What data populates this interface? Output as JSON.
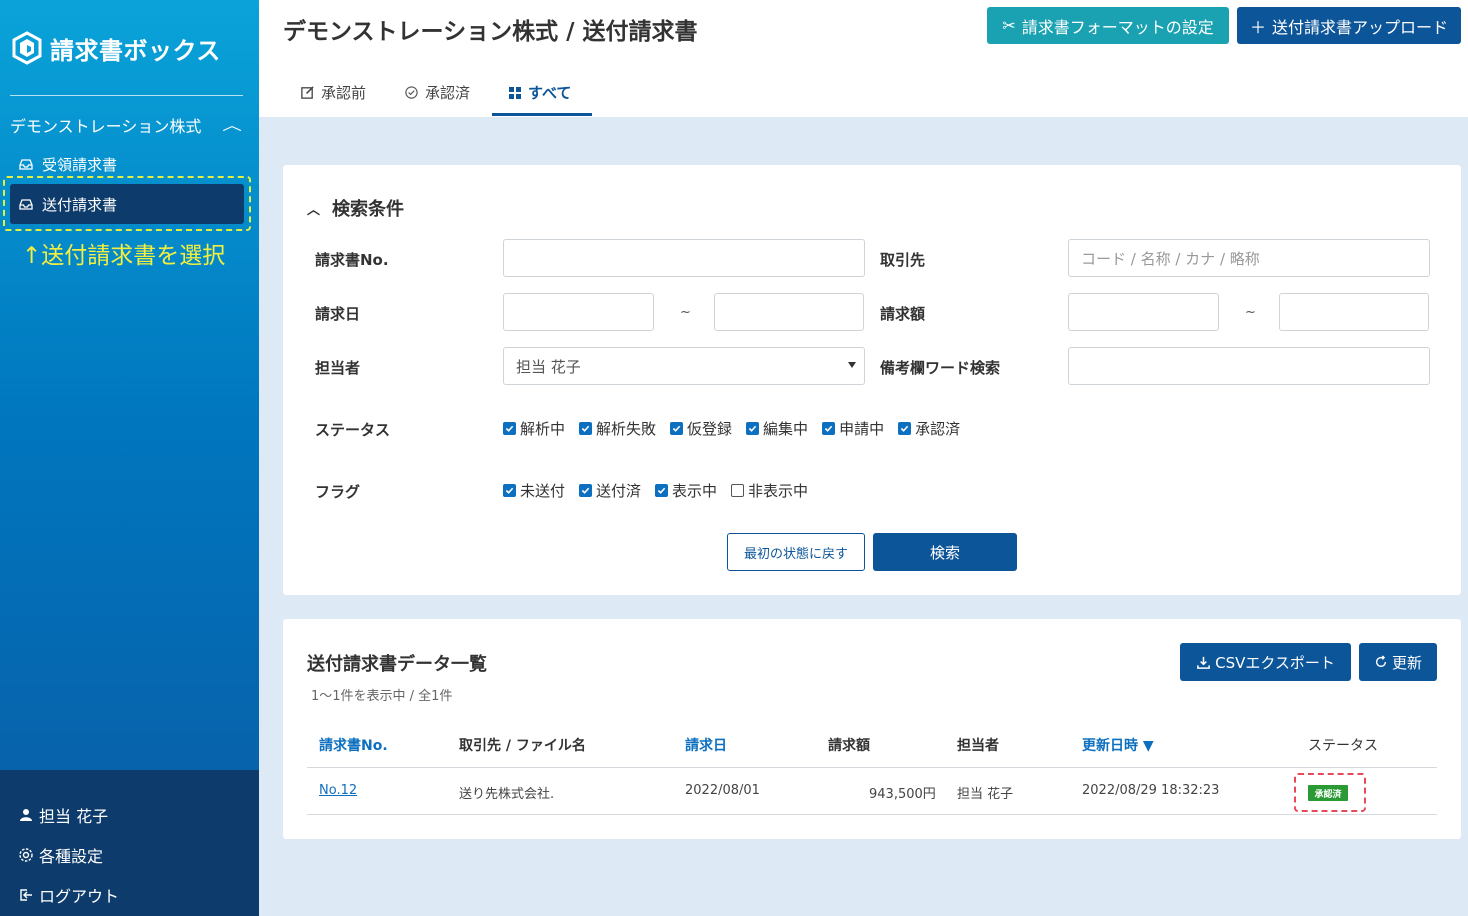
{
  "sidebar": {
    "app_name": "請求書ボックス",
    "company": "デモンストレーション株式",
    "items": [
      {
        "label": "受領請求書"
      },
      {
        "label": "送付請求書"
      }
    ],
    "annotation": "↑送付請求書を選択",
    "user": "担当 花子",
    "settings": "各種設定",
    "logout": "ログアウト"
  },
  "header": {
    "title": "デモンストレーション株式 / 送付請求書",
    "format_button": "請求書フォーマットの設定",
    "upload_button": "送付請求書アップロード",
    "tabs": [
      {
        "label": "承認前"
      },
      {
        "label": "承認済"
      },
      {
        "label": "すべて"
      }
    ]
  },
  "search": {
    "title": "検索条件",
    "invoice_no_label": "請求書No.",
    "partner_label": "取引先",
    "partner_placeholder": "コード / 名称 / カナ / 略称",
    "date_label": "請求日",
    "amount_label": "請求額",
    "tilde": "~",
    "owner_label": "担当者",
    "owner_value": "担当 花子",
    "memo_label": "備考欄ワード検索",
    "status_label": "ステータス",
    "status_options": [
      {
        "label": "解析中",
        "checked": true
      },
      {
        "label": "解析失敗",
        "checked": true
      },
      {
        "label": "仮登録",
        "checked": true
      },
      {
        "label": "編集中",
        "checked": true
      },
      {
        "label": "申請中",
        "checked": true
      },
      {
        "label": "承認済",
        "checked": true
      }
    ],
    "flag_label": "フラグ",
    "flag_options": [
      {
        "label": "未送付",
        "checked": true
      },
      {
        "label": "送付済",
        "checked": true
      },
      {
        "label": "表示中",
        "checked": true
      },
      {
        "label": "非表示中",
        "checked": false
      }
    ],
    "reset_button": "最初の状態に戻す",
    "search_button": "検索"
  },
  "list": {
    "title": "送付請求書データ一覧",
    "count": "1〜1件を表示中 / 全1件",
    "csv_button": "CSVエクスポート",
    "refresh_button": "更新",
    "columns": [
      "請求書No.",
      "取引先 / ファイル名",
      "請求日",
      "請求額",
      "担当者",
      "更新日時 ▼",
      "ステータス"
    ],
    "rows": [
      {
        "no": "No.12",
        "partner": "送り先株式会社.",
        "date": "2022/08/01",
        "amount": "943,500円",
        "owner": "担当 花子",
        "updated": "2022/08/29 18:32:23",
        "status": "承認済"
      }
    ]
  },
  "colors": {
    "primary": "#0d5599",
    "teal": "#1aa2b2",
    "status_approved": "#2a9a35"
  }
}
